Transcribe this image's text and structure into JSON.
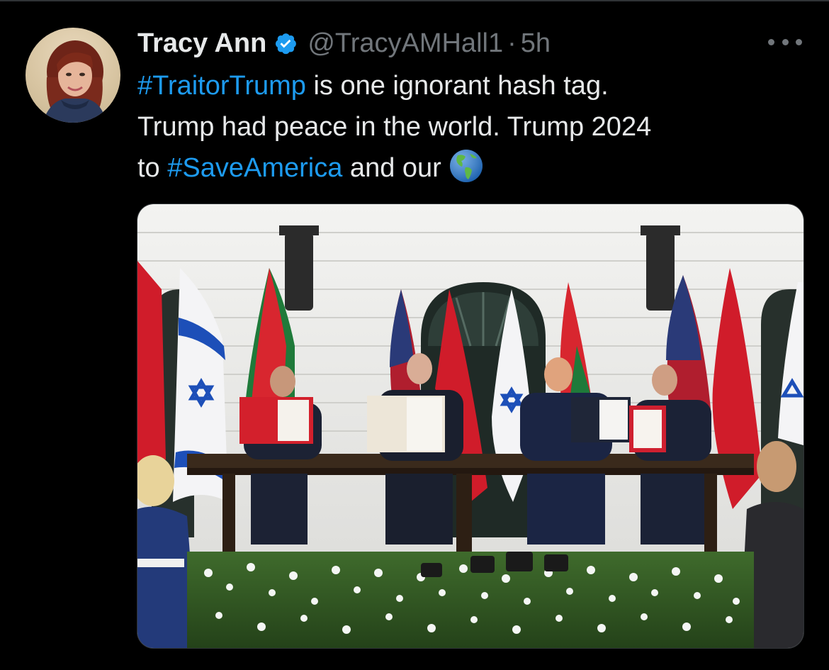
{
  "tweet": {
    "display_name": "Tracy Ann",
    "handle": "@TracyAMHall1",
    "separator": "·",
    "time": "5h",
    "text": {
      "line1_hashtag": "#TraitorTrump",
      "line1_rest": " is one ignorant hash tag.",
      "line2": "Trump had peace in the world. Trump 2024",
      "line3_prefix": "to ",
      "line3_hashtag": "#SaveAmerica",
      "line3_rest": " and our"
    },
    "emoji": "globe-americas-icon"
  },
  "colors": {
    "background": "#000000",
    "text": "#e7e9ea",
    "muted": "#71767b",
    "link": "#1d9bf0",
    "verified": "#1d9bf0"
  }
}
